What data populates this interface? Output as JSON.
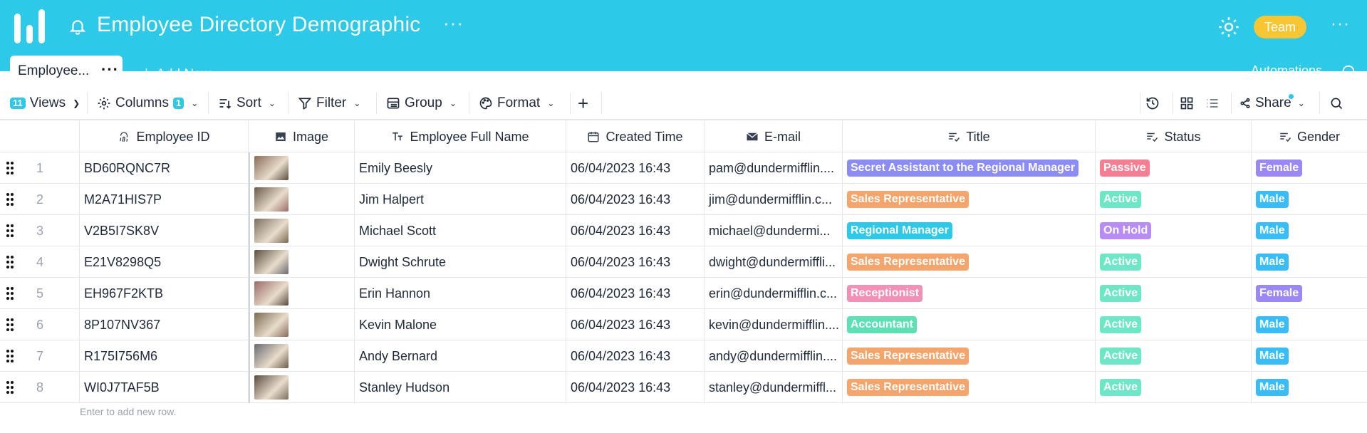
{
  "app": {
    "title": "Employee Directory Demographic",
    "team_label": "Team"
  },
  "tabs": {
    "active_label": "Employee...",
    "add_new": "Add New",
    "automations": "Automations"
  },
  "toolbar": {
    "views_count": "11",
    "views_label": "Views",
    "columns_label": "Columns",
    "columns_count": "1",
    "sort_label": "Sort",
    "filter_label": "Filter",
    "group_label": "Group",
    "format_label": "Format",
    "share_label": "Share"
  },
  "columns": [
    "Employee ID",
    "Image",
    "Employee Full Name",
    "Created Time",
    "E-mail",
    "Title",
    "Status",
    "Gender"
  ],
  "rows": [
    {
      "num": "1",
      "id": "BD60RQNC7R",
      "name": "Emily Beesly",
      "created": "06/04/2023 16:43",
      "email": "pam@dundermifflin....",
      "title": "Secret Assistant to the Regional Manager",
      "status": "Passive",
      "gender": "Female"
    },
    {
      "num": "2",
      "id": "M2A71HIS7P",
      "name": "Jim Halpert",
      "created": "06/04/2023 16:43",
      "email": "jim@dundermifflin.c...",
      "title": "Sales Representative",
      "status": "Active",
      "gender": "Male"
    },
    {
      "num": "3",
      "id": "V2B5I7SK8V",
      "name": "Michael Scott",
      "created": "06/04/2023 16:43",
      "email": "michael@dundermi...",
      "title": "Regional Manager",
      "status": "On Hold",
      "gender": "Male"
    },
    {
      "num": "4",
      "id": "E21V8298Q5",
      "name": "Dwight Schrute",
      "created": "06/04/2023 16:43",
      "email": "dwight@dundermiffli...",
      "title": "Sales Representative",
      "status": "Active",
      "gender": "Male"
    },
    {
      "num": "5",
      "id": "EH967F2KTB",
      "name": "Erin Hannon",
      "created": "06/04/2023 16:43",
      "email": "erin@dundermifflin.c...",
      "title": "Receptionist",
      "status": "Active",
      "gender": "Female"
    },
    {
      "num": "6",
      "id": "8P107NV367",
      "name": "Kevin Malone",
      "created": "06/04/2023 16:43",
      "email": "kevin@dundermifflin....",
      "title": "Accountant",
      "status": "Active",
      "gender": "Male"
    },
    {
      "num": "7",
      "id": "R175I756M6",
      "name": "Andy Bernard",
      "created": "06/04/2023 16:43",
      "email": "andy@dundermifflin....",
      "title": "Sales Representative",
      "status": "Active",
      "gender": "Male"
    },
    {
      "num": "8",
      "id": "WI0J7TAF5B",
      "name": "Stanley Hudson",
      "created": "06/04/2023 16:43",
      "email": "stanley@dundermiffl...",
      "title": "Sales Representative",
      "status": "Active",
      "gender": "Male"
    }
  ],
  "footer": {
    "hint": "Enter to add new row."
  },
  "colors": {
    "brand": "#2cc9e8",
    "team": "#f8c632",
    "title_purple": "#8b8cf6",
    "title_orange": "#f5a56b",
    "title_cyan": "#2cc9e8",
    "title_pink": "#f48fb8",
    "title_green": "#5ee0b5",
    "status_passive": "#f57e93",
    "status_active": "#6ee7c7",
    "status_onhold": "#b78cf4",
    "gender_female": "#9b87f5",
    "gender_male": "#38bdf8"
  }
}
